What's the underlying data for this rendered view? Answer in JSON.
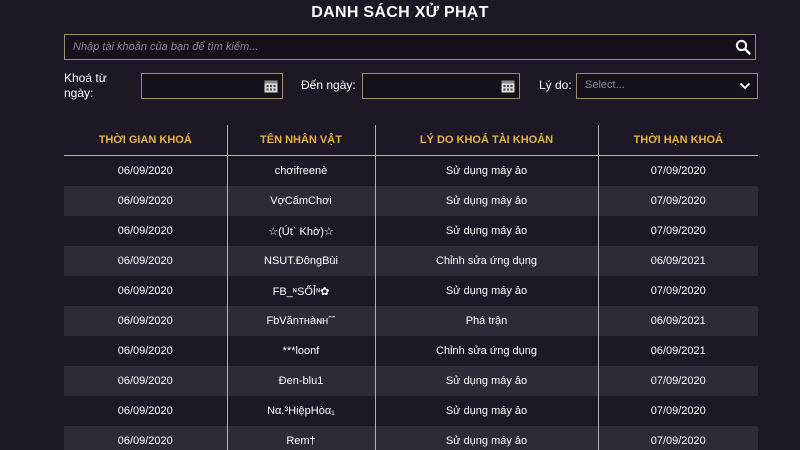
{
  "page_title": "DANH SÁCH XỬ PHẠT",
  "search": {
    "placeholder": "Nhập tài khoản của bạn để tìm kiếm...",
    "icon": "search-icon"
  },
  "filters": {
    "from_label": "Khoá từ ngày:",
    "from_value": "",
    "to_label": "Đến ngày:",
    "to_value": "",
    "reason_label": "Lý do:",
    "reason_value": "Select..."
  },
  "table": {
    "columns": [
      "THỜI GIAN KHOÁ",
      "TÊN NHÂN VẬT",
      "LÝ DO KHOÁ TÀI KHOẢN",
      "THỜI HẠN KHOÁ"
    ],
    "rows": [
      [
        "06/09/2020",
        "chơifreenè",
        "Sử dụng máy ảo",
        "07/09/2020"
      ],
      [
        "06/09/2020",
        "VợCấmChơi",
        "Sử dụng máy ảo",
        "07/09/2020"
      ],
      [
        "06/09/2020",
        "☆(Út` Khờ)☆",
        "Sử dụng máy ảo",
        "07/09/2020"
      ],
      [
        "06/09/2020",
        "NSUT.ĐôngBùi",
        "Chỉnh sửa ứng dụng",
        "06/09/2021"
      ],
      [
        "06/09/2020",
        "FB_ᶰSỐỈᶰ✿",
        "Sử dụng máy ảo",
        "07/09/2020"
      ],
      [
        "06/09/2020",
        "FbVănᴛʜàɴʜˆˆ",
        "Phá trận",
        "06/09/2021"
      ],
      [
        "06/09/2020",
        "***loonf",
        "Chỉnh sửa ứng dụng",
        "06/09/2021"
      ],
      [
        "06/09/2020",
        "Đen-blu1",
        "Sử dụng máy ảo",
        "07/09/2020"
      ],
      [
        "06/09/2020",
        "Nα.³HiệpHòα₁",
        "Sử dụng máy ảo",
        "07/09/2020"
      ],
      [
        "06/09/2020",
        "Rem†",
        "Sử dụng máy ảo",
        "07/09/2020"
      ]
    ]
  },
  "colors": {
    "background": "#1e1726",
    "row_alt": "#2f2938",
    "header_text": "#e3b53f",
    "border": "#9a8f6a"
  }
}
